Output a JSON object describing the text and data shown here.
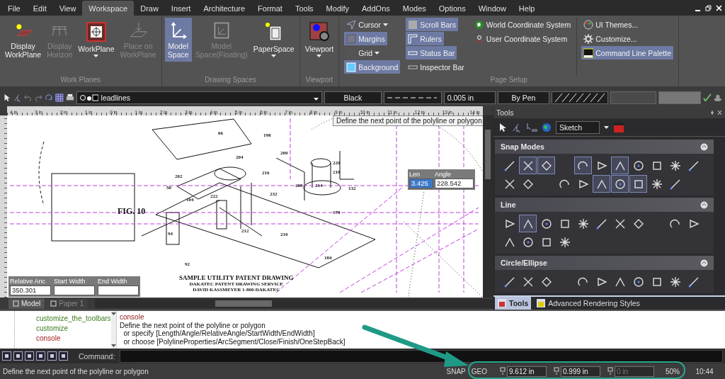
{
  "menu_bar": [
    {
      "label": "File",
      "selected": false
    },
    {
      "label": "Edit",
      "selected": false
    },
    {
      "label": "View",
      "selected": false
    },
    {
      "label": "Workspace",
      "selected": true
    },
    {
      "label": "Draw",
      "selected": false
    },
    {
      "label": "Insert",
      "selected": false
    },
    {
      "label": "Architecture",
      "selected": false
    },
    {
      "label": "Format",
      "selected": false
    },
    {
      "label": "Tools",
      "selected": false
    },
    {
      "label": "Modify",
      "selected": false
    },
    {
      "label": "AddOns",
      "selected": false
    },
    {
      "label": "Modes",
      "selected": false
    },
    {
      "label": "Options",
      "selected": false
    },
    {
      "label": "Window",
      "selected": false
    },
    {
      "label": "Help",
      "selected": false
    }
  ],
  "ribbon": {
    "groups": [
      {
        "title": "Work Planes",
        "kind": "large",
        "buttons": [
          {
            "label": "Display\nWorkPlane",
            "selected": false,
            "disabled": false,
            "dropdown": false
          },
          {
            "label": "Display\nHorizon",
            "selected": false,
            "disabled": true,
            "dropdown": false
          },
          {
            "label": "WorkPlane",
            "selected": false,
            "disabled": false,
            "dropdown": true
          },
          {
            "label": "Place on\nWorkPlane",
            "selected": false,
            "disabled": true,
            "dropdown": false
          }
        ]
      },
      {
        "title": "Drawing Spaces",
        "kind": "large",
        "buttons": [
          {
            "label": "Model\nSpace",
            "selected": true,
            "disabled": false,
            "dropdown": false
          },
          {
            "label": "Model\nSpace(Floating)",
            "selected": false,
            "disabled": true,
            "dropdown": false
          },
          {
            "label": "PaperSpace",
            "selected": false,
            "disabled": false,
            "dropdown": true
          }
        ]
      },
      {
        "title": "Viewport",
        "kind": "large",
        "buttons": [
          {
            "label": "Viewport",
            "selected": false,
            "disabled": false,
            "dropdown": true
          }
        ]
      },
      {
        "title": "Page Setup",
        "kind": "small",
        "columns": [
          [
            {
              "label": "Cursor",
              "selected": false,
              "dropdown": true
            },
            {
              "label": "Margins",
              "selected": true,
              "dropdown": false
            },
            {
              "label": "Grid",
              "selected": false,
              "dropdown": true
            },
            {
              "label": "Background",
              "selected": true,
              "dropdown": false
            }
          ],
          [
            {
              "label": "Scroll Bars",
              "selected": true,
              "dropdown": false
            },
            {
              "label": "Rulers",
              "selected": true,
              "dropdown": false
            },
            {
              "label": "Status Bar",
              "selected": true,
              "dropdown": false
            },
            {
              "label": "Inspector Bar",
              "selected": false,
              "dropdown": false
            }
          ],
          [
            {
              "label": "World Coordinate System",
              "selected": false,
              "dropdown": false
            },
            {
              "label": "User Coordinate System",
              "selected": false,
              "dropdown": false
            }
          ],
          [
            {
              "label": "UI Themes...",
              "selected": false,
              "dropdown": false
            },
            {
              "label": "Customize...",
              "selected": false,
              "dropdown": false
            },
            {
              "label": "Command Line Palette",
              "selected": true,
              "dropdown": false
            }
          ]
        ]
      }
    ]
  },
  "property_bar": {
    "layer": "leadlines",
    "color_name": "Black",
    "line_weight": "0.005 in",
    "pen": "By Pen"
  },
  "ruler_labels": [
    "4 in",
    "3 in",
    "2 in",
    "1 in",
    "0 in",
    "1 in",
    "2 in",
    "3 in",
    "4 in",
    "5 in",
    "6 in",
    "7 in",
    "8 in",
    "9 in",
    "10 in",
    "11 in",
    "12 in",
    "13 in",
    "14 in"
  ],
  "canvas": {
    "tooltip": "Define the next point of the polyline or polygon",
    "figure_label": "FIG. 10",
    "title": "SAMPLE UTILITY PATENT DRAWING",
    "subtitle_lines": [
      "DAKATEC PATENT DRAWING SERVICE",
      "DAVID KASSMEYER 1-800-DAKATEC"
    ],
    "part_labels": [
      "66",
      "198",
      "204",
      "200",
      "202",
      "216",
      "220",
      "218",
      "50",
      "104",
      "222",
      "208",
      "214",
      "232",
      "132",
      "94",
      "92",
      "212",
      "210",
      "178",
      "184"
    ],
    "cursor_fields": [
      {
        "label": "Len",
        "value": "3.425"
      },
      {
        "label": "Angle",
        "value": "228.542"
      }
    ],
    "width_fields": [
      {
        "label": "Relative Anc",
        "value": "350.301"
      },
      {
        "label": "Start Width"
      },
      {
        "label": "End Width"
      }
    ]
  },
  "layout_tabs": [
    {
      "label": "Model",
      "selected": true
    },
    {
      "label": "Paper 1",
      "selected": false
    }
  ],
  "tools_panel": {
    "title": "Tools",
    "style": "Sketch",
    "sections": [
      {
        "title": "Snap Modes",
        "tools": [
          {
            "selected": false
          },
          {
            "selected": true
          },
          {
            "selected": true
          },
          {
            "selected": false
          },
          {
            "selected": true
          },
          {
            "selected": false
          },
          {
            "selected": true
          },
          {
            "selected": false
          },
          {
            "selected": false
          },
          {
            "selected": false
          },
          {
            "selected": false
          },
          {
            "selected": false
          },
          {
            "selected": false
          },
          {
            "selected": false
          },
          {
            "selected": false
          },
          {
            "selected": false
          },
          {
            "selected": true
          },
          {
            "selected": true
          },
          {
            "selected": true
          },
          {
            "selected": false
          },
          {
            "selected": false
          }
        ]
      },
      {
        "title": "Line",
        "tools": [
          {
            "selected": false
          },
          {
            "selected": true
          },
          {
            "selected": false
          },
          {
            "selected": false
          },
          {
            "selected": false
          },
          {
            "selected": false
          },
          {
            "selected": false
          },
          {
            "selected": false
          },
          {
            "selected": false
          },
          {
            "selected": false
          },
          {
            "selected": false
          },
          {
            "selected": false
          },
          {
            "selected": false
          },
          {
            "selected": false
          },
          {
            "selected": false
          }
        ]
      },
      {
        "title": "Circle/Ellipse",
        "tools": [
          {
            "selected": false
          },
          {
            "selected": false
          },
          {
            "selected": false
          },
          {
            "selected": false
          },
          {
            "selected": false
          },
          {
            "selected": false
          },
          {
            "selected": false
          },
          {
            "selected": false
          },
          {
            "selected": false
          },
          {
            "selected": false
          },
          {
            "selected": false
          }
        ]
      }
    ],
    "tabs": [
      {
        "label": "Tools",
        "selected": true
      },
      {
        "label": "Advanced Rendering Styles",
        "selected": false
      }
    ]
  },
  "command_tree": [
    {
      "label": "customize_the_toolbars",
      "selected": false
    },
    {
      "label": "customize",
      "selected": false
    },
    {
      "label": "console",
      "selected": true
    }
  ],
  "console_lines": [
    {
      "text": "console",
      "kind": "command"
    },
    {
      "text": "Define the next point of the polyline or polygon",
      "kind": "message"
    },
    {
      "text": "  or specify [Length/Angle/RelativeAngle/StartWidth/EndWidth]",
      "kind": "message"
    },
    {
      "text": "  or choose [PolylineProperties/ArcSegment/Close/Finish/OneStepBack]",
      "kind": "message"
    }
  ],
  "command_label": "Command:",
  "status_bar": {
    "message": "Define the next point of the polyline or polygon",
    "toggles": [
      "SNAP",
      "GEO"
    ],
    "coordinates": [
      {
        "value": "9.612 in",
        "disabled": false
      },
      {
        "value": "0.999 in",
        "disabled": false
      },
      {
        "value": "0 in",
        "disabled": true
      }
    ],
    "zoom": "50%",
    "time": "10:44"
  }
}
